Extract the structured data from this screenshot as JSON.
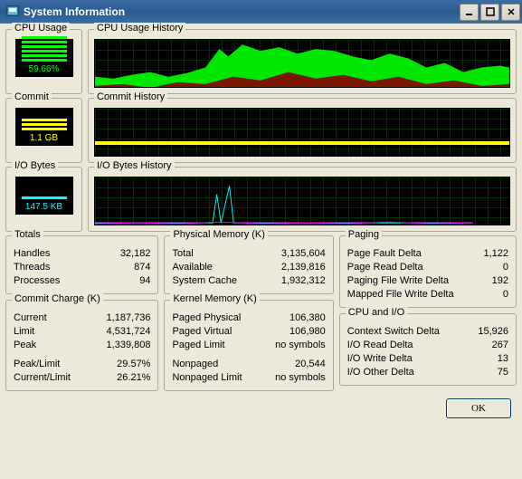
{
  "window": {
    "title": "System Information"
  },
  "gauges": {
    "cpu": {
      "label": "CPU Usage",
      "value": "59.66%"
    },
    "commit": {
      "label": "Commit",
      "value": "1.1 GB"
    },
    "io": {
      "label": "I/O Bytes",
      "value": "147.5 KB"
    }
  },
  "histories": {
    "cpu": "CPU Usage History",
    "commit": "Commit History",
    "io": "I/O Bytes History"
  },
  "totals": {
    "title": "Totals",
    "handles_l": "Handles",
    "handles_v": "32,182",
    "threads_l": "Threads",
    "threads_v": "874",
    "processes_l": "Processes",
    "processes_v": "94"
  },
  "commitCharge": {
    "title": "Commit Charge (K)",
    "current_l": "Current",
    "current_v": "1,187,736",
    "limit_l": "Limit",
    "limit_v": "4,531,724",
    "peak_l": "Peak",
    "peak_v": "1,339,808",
    "peaklimit_l": "Peak/Limit",
    "peaklimit_v": "29.57%",
    "currentlimit_l": "Current/Limit",
    "currentlimit_v": "26.21%"
  },
  "physMem": {
    "title": "Physical Memory (K)",
    "total_l": "Total",
    "total_v": "3,135,604",
    "avail_l": "Available",
    "avail_v": "2,139,816",
    "cache_l": "System Cache",
    "cache_v": "1,932,312"
  },
  "kernel": {
    "title": "Kernel Memory (K)",
    "pp_l": "Paged Physical",
    "pp_v": "106,380",
    "pv_l": "Paged Virtual",
    "pv_v": "106,980",
    "pl_l": "Paged Limit",
    "pl_v": "no symbols",
    "np_l": "Nonpaged",
    "np_v": "20,544",
    "npl_l": "Nonpaged Limit",
    "npl_v": "no symbols"
  },
  "paging": {
    "title": "Paging",
    "pfd_l": "Page Fault Delta",
    "pfd_v": "1,122",
    "prd_l": "Page Read Delta",
    "prd_v": "0",
    "pfwd_l": "Paging File Write Delta",
    "pfwd_v": "192",
    "mfwd_l": "Mapped File Write Delta",
    "mfwd_v": "0"
  },
  "cpuio": {
    "title": "CPU and I/O",
    "csd_l": "Context Switch Delta",
    "csd_v": "15,926",
    "ird_l": "I/O Read Delta",
    "ird_v": "267",
    "iwd_l": "I/O Write Delta",
    "iwd_v": "13",
    "iod_l": "I/O Other Delta",
    "iod_v": "75"
  },
  "buttons": {
    "ok": "OK"
  }
}
